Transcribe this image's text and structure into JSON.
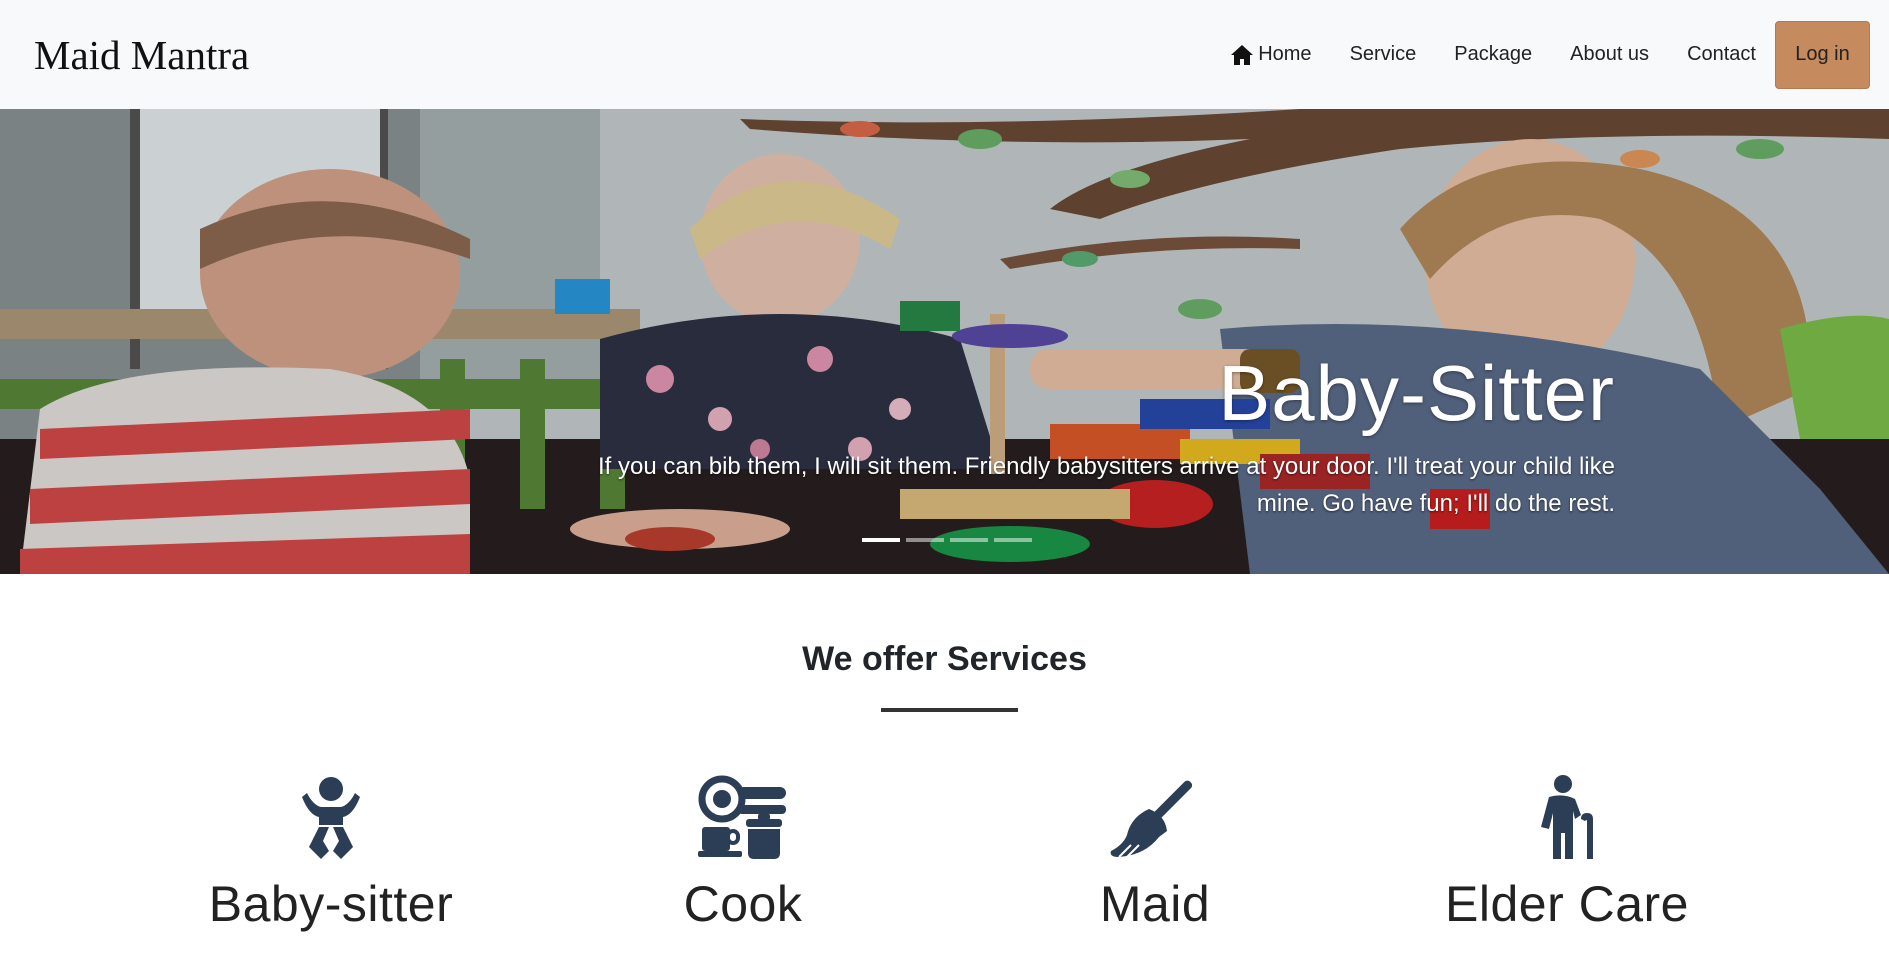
{
  "navbar": {
    "brand": "Maid Mantra",
    "links": [
      {
        "label": "Home",
        "icon": "home-icon"
      },
      {
        "label": "Service"
      },
      {
        "label": "Package"
      },
      {
        "label": "About us"
      },
      {
        "label": "Contact"
      }
    ],
    "login_label": "Log in",
    "login_color": "#c58a5e"
  },
  "hero": {
    "title": "Baby-Sitter",
    "text": "If you can bib them, I will sit them. Friendly babysitters arrive at your door. I'll treat your child like mine. Go have fun; I'll do the rest.",
    "slide_count": 4,
    "active_slide": 1
  },
  "services": {
    "title": "We offer Services",
    "items": [
      {
        "label": "Baby-sitter",
        "icon": "baby-icon"
      },
      {
        "label": "Cook",
        "icon": "cooking-icon"
      },
      {
        "label": "Maid",
        "icon": "broom-icon"
      },
      {
        "label": "Elder Care",
        "icon": "elderly-person-icon"
      }
    ],
    "icon_color": "#2c3e55"
  }
}
